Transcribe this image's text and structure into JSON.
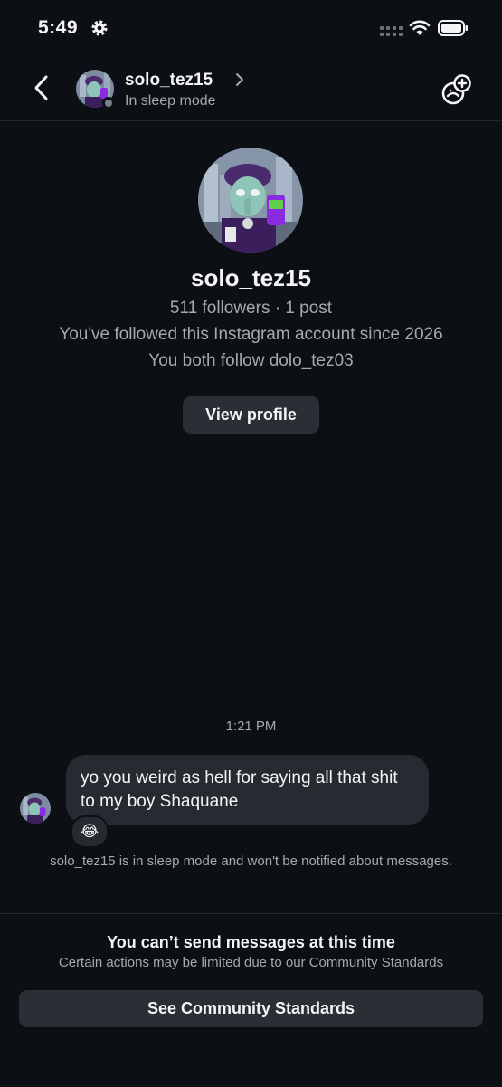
{
  "status_bar": {
    "time": "5:49"
  },
  "header": {
    "username": "solo_tez15",
    "status": "In sleep mode"
  },
  "profile": {
    "username": "solo_tez15",
    "stats": "511 followers · 1 post",
    "follow_since": "You've followed this Instagram account since 2026",
    "mutual": "You both follow dolo_tez03",
    "view_profile_label": "View profile"
  },
  "conversation": {
    "timestamp": "1:21 PM",
    "message_text": "yo you weird as hell for saying all that shit to my boy Shaquane",
    "reaction_emoji": "😂",
    "sleep_notice": "solo_tez15 is in sleep mode and won't be notified about messages."
  },
  "footer": {
    "title": "You can’t send messages at this time",
    "subtitle": "Certain actions may be limited due to our Community Standards",
    "button_label": "See Community Standards"
  },
  "colors": {
    "background": "#0c0f14",
    "bubble": "#262a31",
    "button": "#2a2e35",
    "secondary_text": "#a5a9b0"
  }
}
